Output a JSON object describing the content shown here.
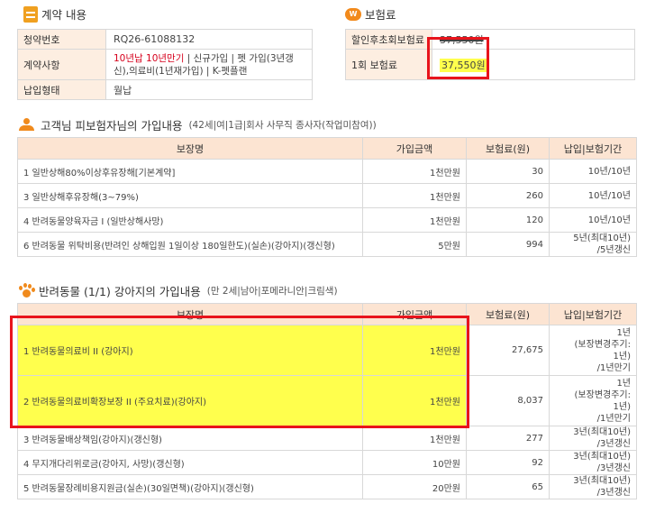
{
  "contract": {
    "title": "계약 내용",
    "rows": [
      {
        "label": "청약번호",
        "value": "RQ26-61088132"
      },
      {
        "label": "계약사항",
        "value_red": "10년납 10년만기",
        "value_rest": " | 신규가입 | 펫 가입(3년갱신),의료비(1년재가입) | K-펫플랜"
      },
      {
        "label": "납입형태",
        "value": "월납"
      }
    ]
  },
  "premium": {
    "title": "보험료",
    "rows": [
      {
        "label": "할인후초회보험료",
        "value": "37,550원"
      },
      {
        "label": "1회 보험료",
        "value": "37,550원"
      }
    ]
  },
  "customer": {
    "title": "고객님 피보험자님의 가입내용",
    "subtitle": "(42세|여|1급|회사 사무직 종사자(작업미참여))",
    "headers": [
      "보장명",
      "가입금액",
      "보험료(원)",
      "납입|보험기간"
    ],
    "rows": [
      {
        "name": "1  일반상해80%이상후유장해[기본계약]",
        "amount": "1천만원",
        "premium": "30",
        "period": [
          "10년/10년"
        ]
      },
      {
        "name": "3  일반상해후유장해(3~79%)",
        "amount": "1천만원",
        "premium": "260",
        "period": [
          "10년/10년"
        ]
      },
      {
        "name": "4  반려동물양육자금 I (일반상해사망)",
        "amount": "1천만원",
        "premium": "120",
        "period": [
          "10년/10년"
        ]
      },
      {
        "name": "6  반려동물 위탁비용(반려인 상해입원 1일이상 180일한도)(실손)(강아지)(갱신형)",
        "amount": "5만원",
        "premium": "994",
        "period": [
          "5년(최대10년)",
          "/5년갱신"
        ]
      }
    ]
  },
  "pet": {
    "title": "반려동물 (1/1) 강아지의 가입내용",
    "subtitle": "(만 2세|남아|포메라니안|크림색)",
    "headers": [
      "보장명",
      "가입금액",
      "보험료(원)",
      "납입|보험기간"
    ],
    "rows": [
      {
        "name": "1  반려동물의료비 II (강아지)",
        "amount": "1천만원",
        "premium": "27,675",
        "period": [
          "1년",
          "(보장변경주기:",
          "1년)",
          "/1년만기"
        ]
      },
      {
        "name": "2  반려동물의료비확장보장 II (주요치료)(강아지)",
        "amount": "1천만원",
        "premium": "8,037",
        "period": [
          "1년",
          "(보장변경주기:",
          "1년)",
          "/1년만기"
        ]
      },
      {
        "name": "3  반려동물배상책임(강아지)(갱신형)",
        "amount": "1천만원",
        "premium": "277",
        "period": [
          "3년(최대10년)",
          "/3년갱신"
        ]
      },
      {
        "name": "4  무지개다리위로금(강아지, 사망)(갱신형)",
        "amount": "10만원",
        "premium": "92",
        "period": [
          "3년(최대10년)",
          "/3년갱신"
        ]
      },
      {
        "name": "5  반려동물장례비용지원금(실손)(30일면책)(강아지)(갱신형)",
        "amount": "20만원",
        "premium": "65",
        "period": [
          "3년(최대10년)",
          "/3년갱신"
        ]
      }
    ]
  }
}
